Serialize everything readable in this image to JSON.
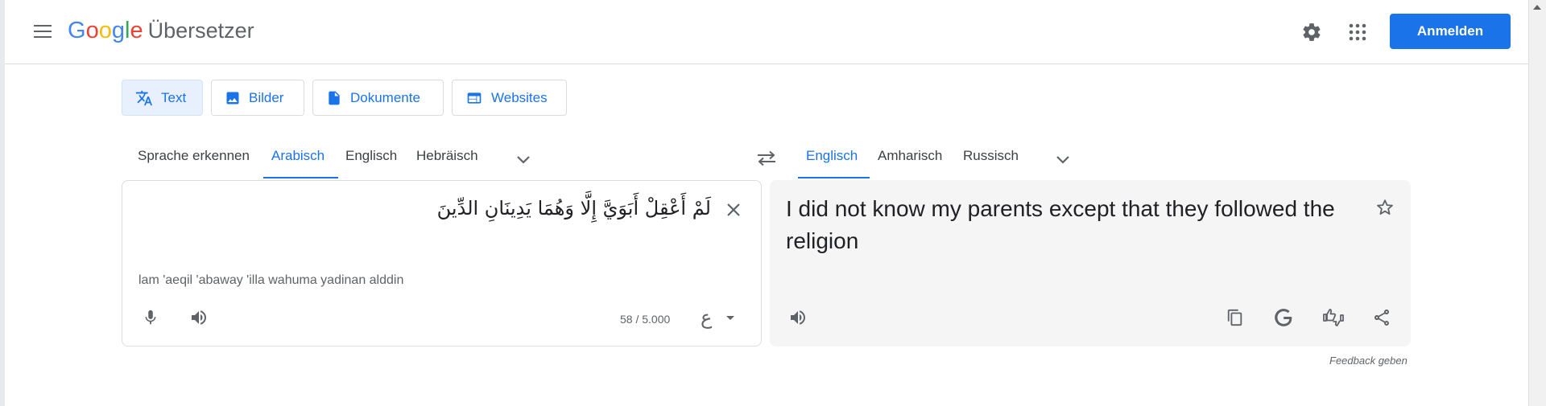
{
  "header": {
    "logo_letters": [
      "G",
      "o",
      "o",
      "g",
      "l",
      "e"
    ],
    "product": "Übersetzer",
    "signin_label": "Anmelden"
  },
  "modes": [
    {
      "label": "Text",
      "icon": "translate-icon",
      "active": true
    },
    {
      "label": "Bilder",
      "icon": "image-icon",
      "active": false
    },
    {
      "label": "Dokumente",
      "icon": "document-icon",
      "active": false
    },
    {
      "label": "Websites",
      "icon": "website-icon",
      "active": false
    }
  ],
  "source_langs": [
    "Sprache erkennen",
    "Arabisch",
    "Englisch",
    "Hebräisch"
  ],
  "target_langs": [
    "Englisch",
    "Amharisch",
    "Russisch"
  ],
  "source": {
    "text": "لَمْ أَعْقِلْ أَبَوَيَّ إِلَّا وَهُمَا يَدِينَانِ الدِّينَ",
    "transliteration": "lam 'aeqil 'abaway 'illa wahuma yadinan alddin",
    "char_count": "58 / 5.000",
    "keyboard_char": "ع"
  },
  "target": {
    "text": "I did not know my parents except that they followed the religion"
  },
  "feedback_label": "Feedback geben",
  "colors": {
    "accent": "#1a73e8",
    "active_tab_bg": "#e8f0fe",
    "target_panel_bg": "#f5f5f5"
  }
}
